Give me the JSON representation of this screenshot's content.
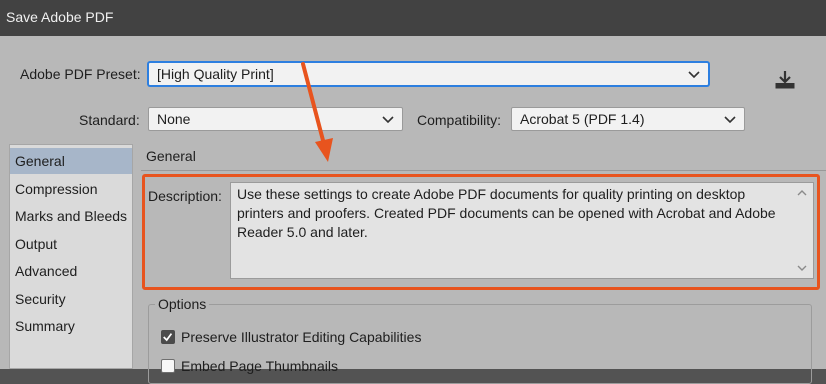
{
  "window": {
    "title": "Save Adobe PDF"
  },
  "preset": {
    "label": "Adobe PDF Preset:",
    "value": "[High Quality Print]",
    "save_icon": "save-preset-icon"
  },
  "standard": {
    "label": "Standard:",
    "value": "None"
  },
  "compatibility": {
    "label": "Compatibility:",
    "value": "Acrobat 5 (PDF 1.4)"
  },
  "sidebar": {
    "items": [
      {
        "label": "General",
        "selected": true
      },
      {
        "label": "Compression"
      },
      {
        "label": "Marks and Bleeds"
      },
      {
        "label": "Output"
      },
      {
        "label": "Advanced"
      },
      {
        "label": "Security"
      },
      {
        "label": "Summary"
      }
    ]
  },
  "panel": {
    "title": "General",
    "description_label": "Description:",
    "description_text": "Use these settings to create Adobe PDF documents for quality printing on desktop printers and proofers.  Created PDF documents can be opened with Acrobat and Adobe Reader 5.0 and later."
  },
  "options": {
    "legend": "Options",
    "items": [
      {
        "label": "Preserve Illustrator Editing Capabilities",
        "checked": true
      },
      {
        "label": "Embed Page Thumbnails",
        "checked": false
      }
    ]
  },
  "colors": {
    "highlight": "#e8541e",
    "arrow": "#e8541e",
    "selection": "#a7b6c9"
  }
}
